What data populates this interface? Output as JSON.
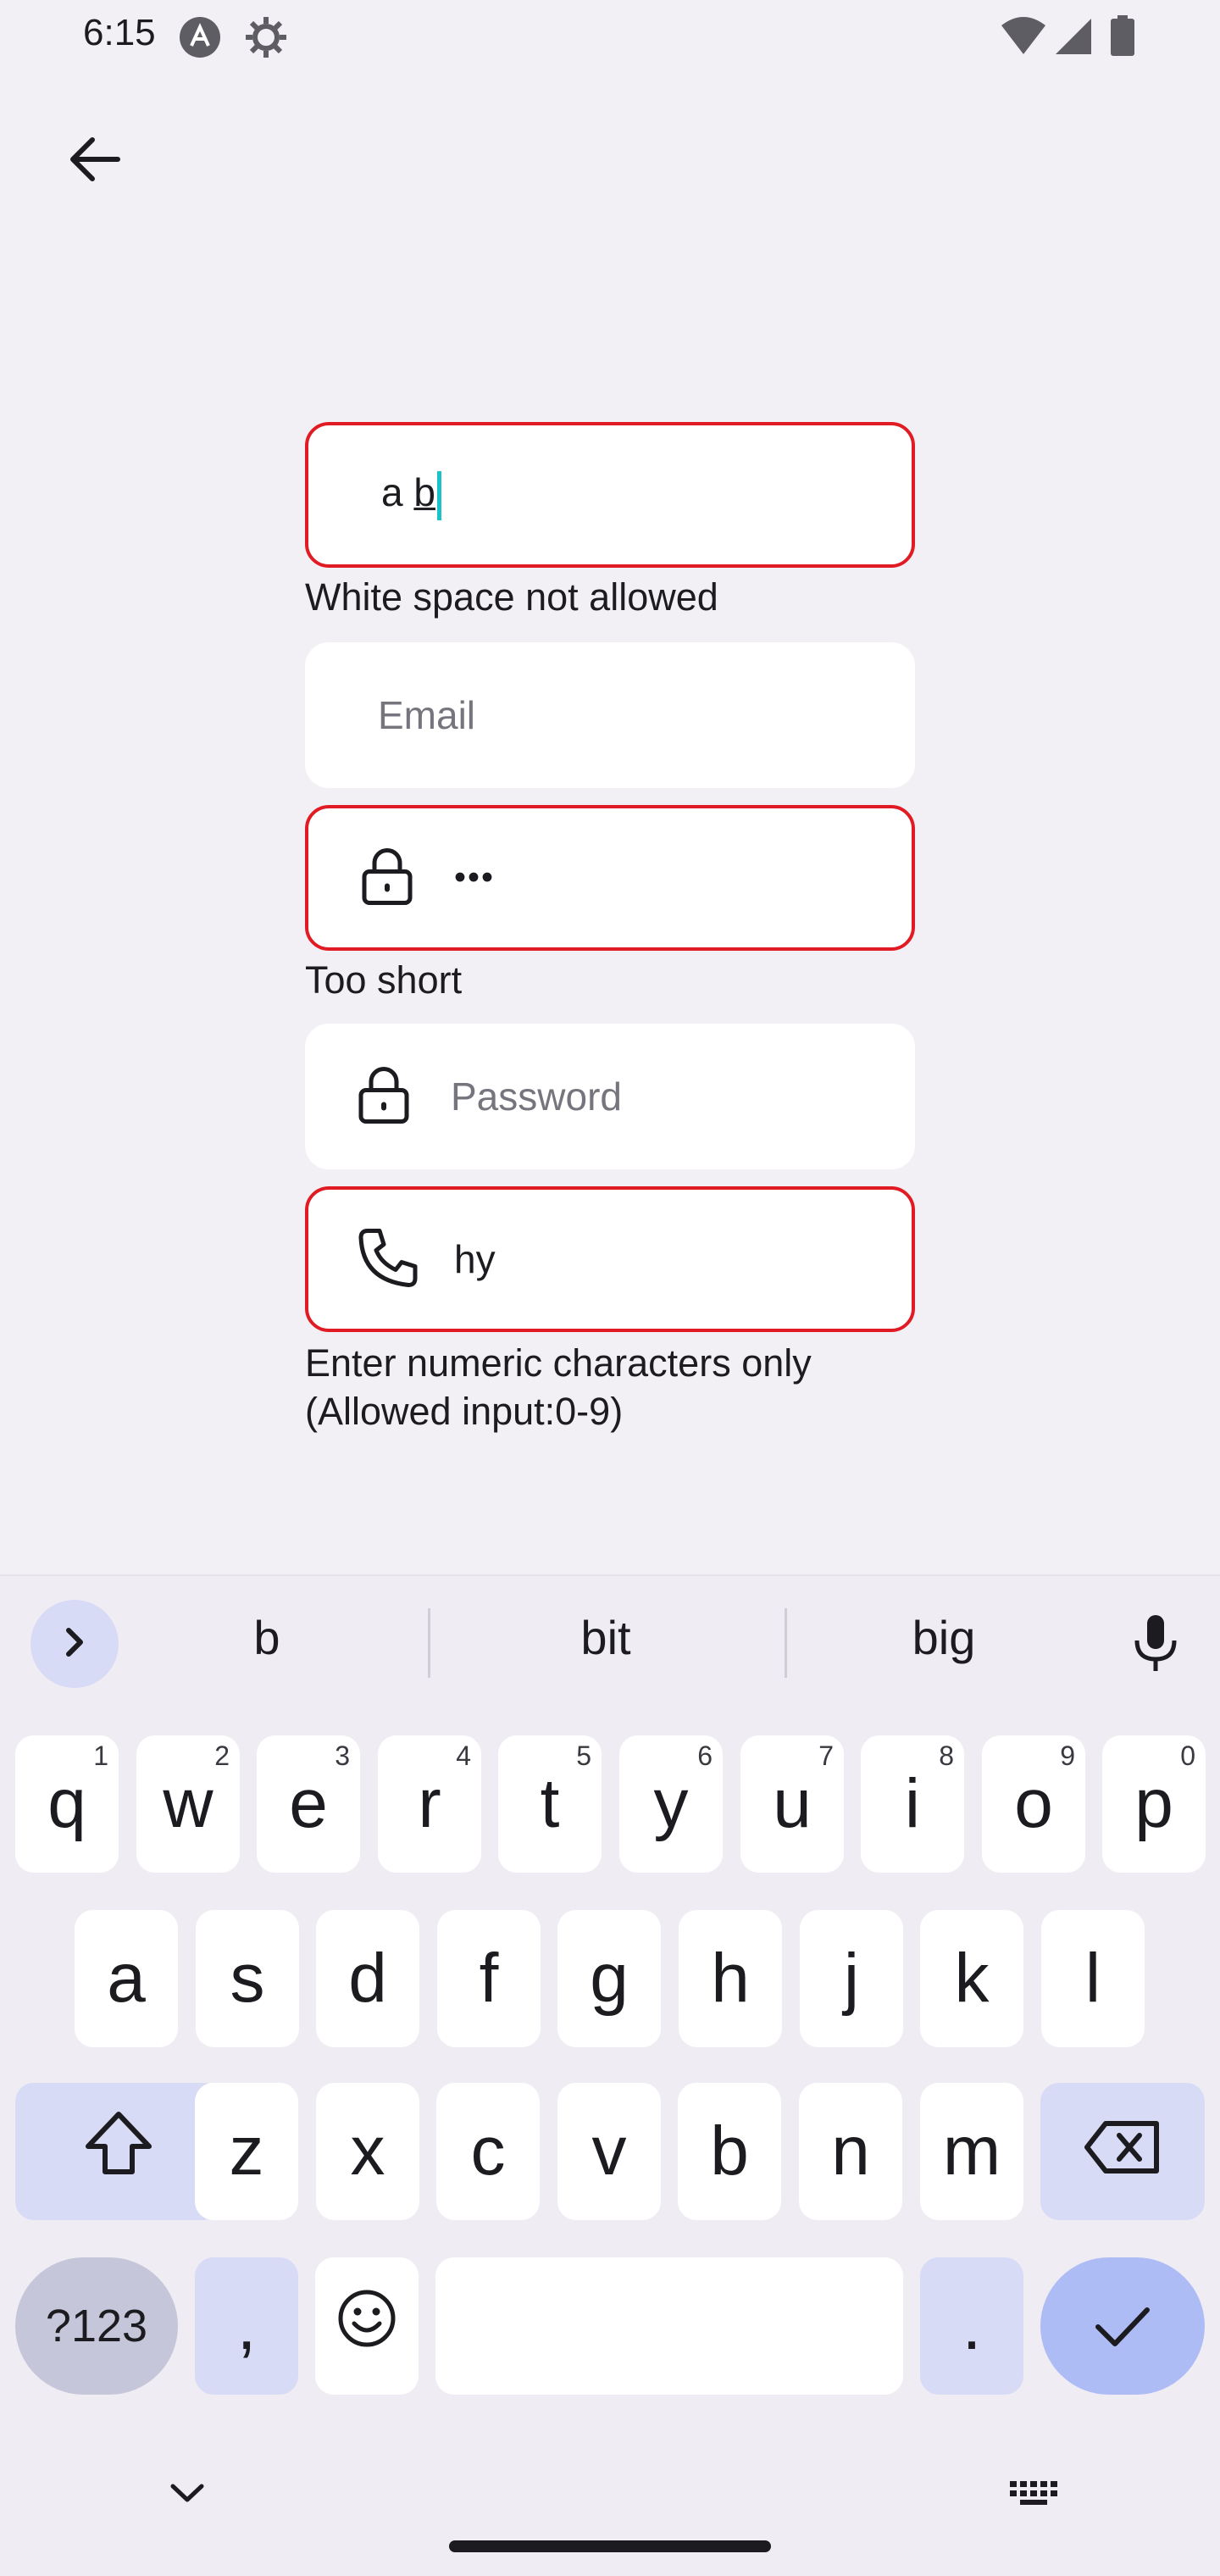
{
  "status_bar": {
    "time": "6:15",
    "icons_left": [
      "a-logo-icon",
      "settings-gear-icon"
    ],
    "icons_right": [
      "wifi-icon",
      "cell-signal-icon",
      "battery-icon"
    ]
  },
  "app_bar": {
    "back_icon": "arrow-back-icon"
  },
  "form": {
    "username": {
      "value_prefix": "a ",
      "value_underlined": "b",
      "error": "White space not allowed"
    },
    "email": {
      "placeholder": "Email"
    },
    "password_1": {
      "icon": "lock-icon",
      "value": "•••",
      "error": "Too short"
    },
    "password_2": {
      "icon": "lock-icon",
      "placeholder": "Password"
    },
    "phone": {
      "icon": "phone-icon",
      "value": "hy",
      "error_line1": "Enter numeric characters only",
      "error_line2": "(Allowed input:0-9)"
    }
  },
  "keyboard": {
    "suggestions": [
      "b",
      "bit",
      "big"
    ],
    "row1": [
      {
        "k": "q",
        "h": "1"
      },
      {
        "k": "w",
        "h": "2"
      },
      {
        "k": "e",
        "h": "3"
      },
      {
        "k": "r",
        "h": "4"
      },
      {
        "k": "t",
        "h": "5"
      },
      {
        "k": "y",
        "h": "6"
      },
      {
        "k": "u",
        "h": "7"
      },
      {
        "k": "i",
        "h": "8"
      },
      {
        "k": "o",
        "h": "9"
      },
      {
        "k": "p",
        "h": "0"
      }
    ],
    "row2": [
      "a",
      "s",
      "d",
      "f",
      "g",
      "h",
      "j",
      "k",
      "l"
    ],
    "row3": [
      "z",
      "x",
      "c",
      "v",
      "b",
      "n",
      "m"
    ],
    "symbols_label": "?123",
    "comma": ",",
    "period": "."
  },
  "colors": {
    "error": "#e01b24",
    "caret": "#19c3c7",
    "modifier": "#d8dbf6",
    "enter": "#aebcf5"
  }
}
